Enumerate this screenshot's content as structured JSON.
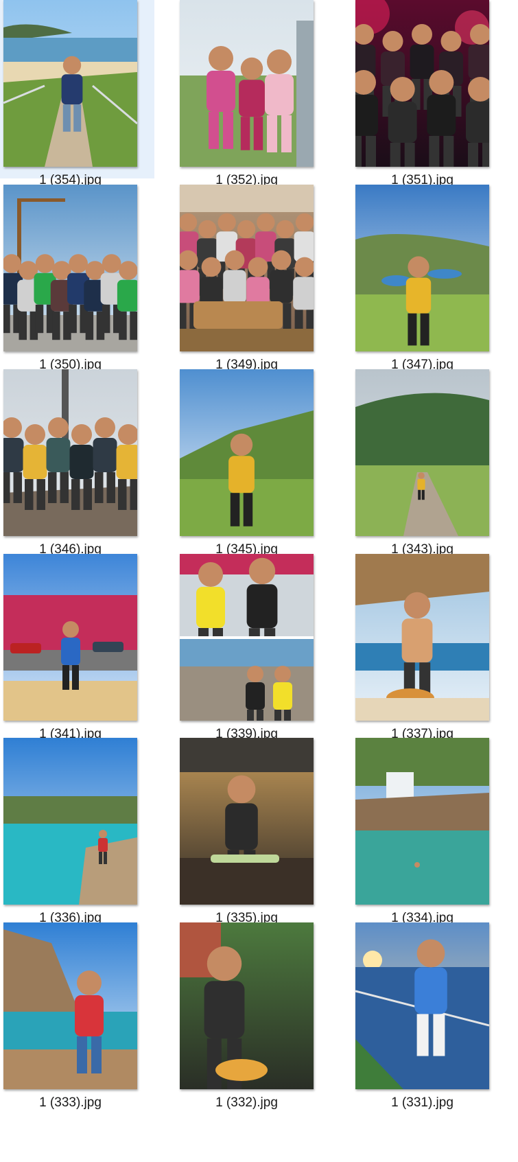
{
  "files": [
    {
      "name": "1 (354).jpg",
      "selected": true,
      "scene": "coast-stairs"
    },
    {
      "name": "1 (352).jpg",
      "selected": false,
      "scene": "family-pink"
    },
    {
      "name": "1 (351).jpg",
      "selected": false,
      "scene": "party-crowd"
    },
    {
      "name": "1 (350).jpg",
      "selected": false,
      "scene": "group-sign"
    },
    {
      "name": "1 (349).jpg",
      "selected": false,
      "scene": "indoor-group"
    },
    {
      "name": "1 (347).jpg",
      "selected": false,
      "scene": "hiker-valley"
    },
    {
      "name": "1 (346).jpg",
      "selected": false,
      "scene": "group-fog"
    },
    {
      "name": "1 (345).jpg",
      "selected": false,
      "scene": "hiker-field"
    },
    {
      "name": "1 (343).jpg",
      "selected": false,
      "scene": "mountain-path"
    },
    {
      "name": "1 (341).jpg",
      "selected": false,
      "scene": "pub-street"
    },
    {
      "name": "1 (339).jpg",
      "selected": false,
      "scene": "collage-tees"
    },
    {
      "name": "1 (337).jpg",
      "selected": false,
      "scene": "cafe-sea"
    },
    {
      "name": "1 (336).jpg",
      "selected": false,
      "scene": "cove-turquoise"
    },
    {
      "name": "1 (335).jpg",
      "selected": false,
      "scene": "restaurant-sushi"
    },
    {
      "name": "1 (334).jpg",
      "selected": false,
      "scene": "cove-swimmer"
    },
    {
      "name": "1 (333).jpg",
      "selected": false,
      "scene": "dock-hat"
    },
    {
      "name": "1 (332).jpg",
      "selected": false,
      "scene": "garden-dish"
    },
    {
      "name": "1 (331).jpg",
      "selected": false,
      "scene": "boat-sunset"
    }
  ],
  "palette": {
    "selection": "#e6f0fb",
    "text": "#1a1a1a"
  }
}
